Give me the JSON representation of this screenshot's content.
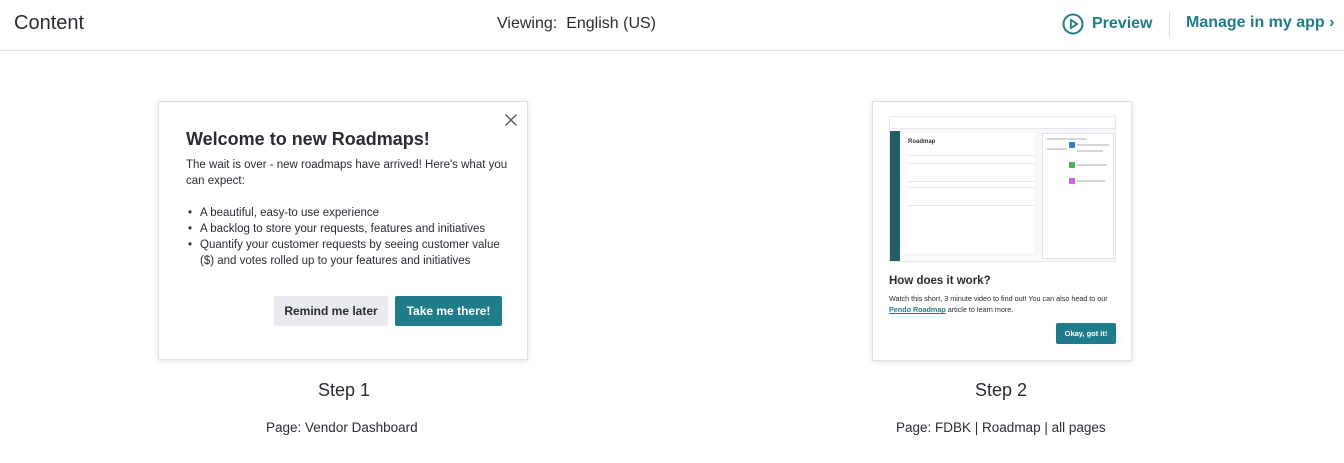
{
  "header": {
    "title": "Content",
    "viewing_label": "Viewing:",
    "viewing_language": "English (US)",
    "preview_label": "Preview",
    "manage_label": "Manage in my app ›"
  },
  "colors": {
    "accent": "#1f7d8a",
    "text": "#2a2c35",
    "secondary_button": "#e9ebf0"
  },
  "steps": [
    {
      "step_label": "Step 1",
      "page_label": "Page: Vendor Dashboard",
      "guide": {
        "title": "Welcome to new Roadmaps!",
        "intro": "The wait is over - new roadmaps have arrived! Here's what you can expect:",
        "bullets": [
          "A beautiful, easy-to use experience",
          "A backlog to store your requests, features and initiatives",
          "Quantify your customer requests by seeing customer value ($) and votes rolled up to your features and initiatives"
        ],
        "secondary_button": "Remind me later",
        "primary_button": "Take me there!",
        "close_icon": "close-icon"
      }
    },
    {
      "step_label": "Step 2",
      "page_label": "Page: FDBK | Roadmap | all pages",
      "guide": {
        "thumbnail_title": "Roadmap",
        "title": "How does it work?",
        "desc_before": "Watch this short, 3 minute video to find out! You can also head to our ",
        "desc_link": "Pendo Roadmap",
        "desc_after": " article to learn more.",
        "primary_button": "Okay, got it!"
      }
    }
  ]
}
